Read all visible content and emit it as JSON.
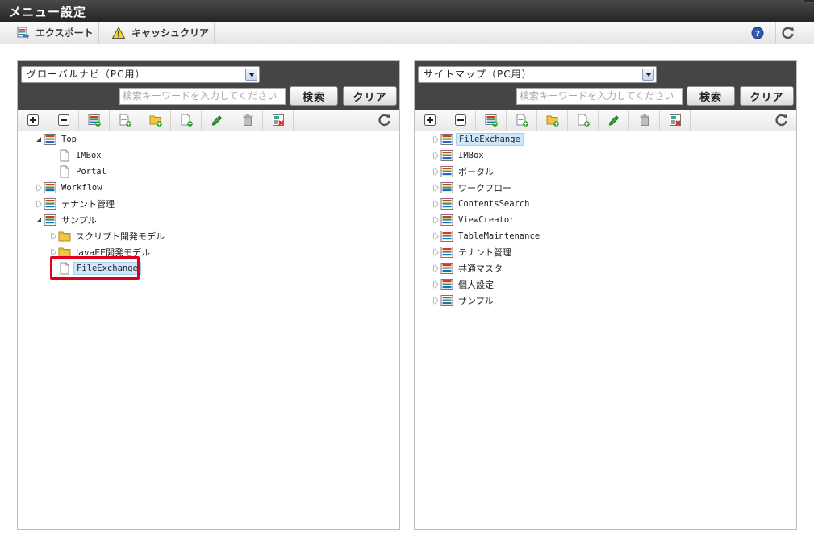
{
  "title": "メニュー設定",
  "toolbar": {
    "export_label": "エクスポート",
    "cache_clear_label": "キャッシュクリア"
  },
  "left_panel": {
    "select_value": "グローバルナビ（PC用）",
    "search_placeholder": "検索キーワードを入力してください",
    "search_button": "検索",
    "clear_button": "クリア",
    "tree": [
      {
        "label": "Top",
        "icon": "menu-list-icon",
        "toggle": "open",
        "level": 0
      },
      {
        "label": "IMBox",
        "icon": "page-icon",
        "toggle": "none",
        "level": 1
      },
      {
        "label": "Portal",
        "icon": "page-icon",
        "toggle": "none",
        "level": 1
      },
      {
        "label": "Workflow",
        "icon": "menu-list-icon",
        "toggle": "closed",
        "level": 0
      },
      {
        "label": "テナント管理",
        "icon": "menu-list-icon",
        "toggle": "closed",
        "level": 0
      },
      {
        "label": "サンプル",
        "icon": "menu-list-icon",
        "toggle": "open",
        "level": 0
      },
      {
        "label": "スクリプト開発モデル",
        "icon": "folder-icon",
        "toggle": "closed",
        "level": 1
      },
      {
        "label": "JavaEE開発モデル",
        "icon": "folder-icon",
        "toggle": "closed",
        "level": 1
      },
      {
        "label": "FileExchange",
        "icon": "page-icon",
        "toggle": "none",
        "level": 1,
        "selected": true
      }
    ]
  },
  "right_panel": {
    "select_value": "サイトマップ（PC用）",
    "search_placeholder": "検索キーワードを入力してください",
    "search_button": "検索",
    "clear_button": "クリア",
    "tree": [
      {
        "label": "FileExchange",
        "selected": true
      },
      {
        "label": "IMBox"
      },
      {
        "label": "ポータル"
      },
      {
        "label": "ワークフロー"
      },
      {
        "label": "ContentsSearch"
      },
      {
        "label": "ViewCreator"
      },
      {
        "label": "TableMaintenance"
      },
      {
        "label": "テナント管理"
      },
      {
        "label": "共通マスタ"
      },
      {
        "label": "個人設定"
      },
      {
        "label": "サンプル"
      }
    ]
  },
  "tree_toolbar_icons": [
    "expand-all-icon",
    "collapse-all-icon",
    "add-menu-icon",
    "add-page-icon",
    "add-folder-icon",
    "add-item-icon",
    "edit-icon",
    "delete-icon",
    "move-icon",
    "refresh-icon"
  ],
  "colors": {
    "highlight": "#e0001b",
    "selection": "#cfe7fa",
    "header": "#454545"
  }
}
